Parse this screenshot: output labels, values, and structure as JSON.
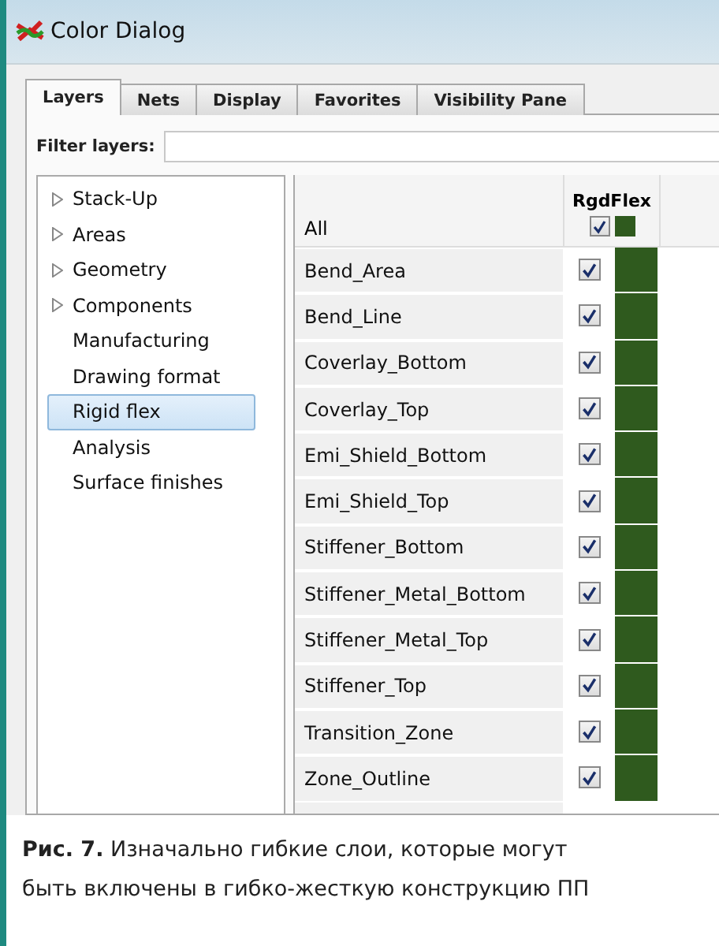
{
  "window": {
    "title": "Color Dialog"
  },
  "tabs": [
    {
      "label": "Layers",
      "selected": true
    },
    {
      "label": "Nets",
      "selected": false
    },
    {
      "label": "Display",
      "selected": false
    },
    {
      "label": "Favorites",
      "selected": false
    },
    {
      "label": "Visibility Pane",
      "selected": false
    }
  ],
  "filter": {
    "label": "Filter layers:"
  },
  "tree": [
    {
      "label": "Stack-Up",
      "kind": "folder",
      "selected": false
    },
    {
      "label": "Areas",
      "kind": "folder",
      "selected": false
    },
    {
      "label": "Geometry",
      "kind": "folder",
      "selected": false
    },
    {
      "label": "Components",
      "kind": "folder",
      "selected": false
    },
    {
      "label": "Manufacturing",
      "kind": "leaf",
      "selected": false
    },
    {
      "label": "Drawing format",
      "kind": "leaf",
      "selected": false
    },
    {
      "label": "Rigid flex",
      "kind": "leaf",
      "selected": true
    },
    {
      "label": "Analysis",
      "kind": "leaf",
      "selected": false
    },
    {
      "label": "Surface finishes",
      "kind": "leaf",
      "selected": false
    }
  ],
  "table": {
    "column": "RgdFlex",
    "all": {
      "label": "All",
      "checked": true,
      "color": "#2f5a1e"
    },
    "rows": [
      {
        "name": "Bend_Area",
        "checked": true,
        "color": "#2f5a1e"
      },
      {
        "name": "Bend_Line",
        "checked": true,
        "color": "#2f5a1e"
      },
      {
        "name": "Coverlay_Bottom",
        "checked": true,
        "color": "#2f5a1e"
      },
      {
        "name": "Coverlay_Top",
        "checked": true,
        "color": "#2f5a1e"
      },
      {
        "name": "Emi_Shield_Bottom",
        "checked": true,
        "color": "#2f5a1e"
      },
      {
        "name": "Emi_Shield_Top",
        "checked": true,
        "color": "#2f5a1e"
      },
      {
        "name": "Stiffener_Bottom",
        "checked": true,
        "color": "#2f5a1e"
      },
      {
        "name": "Stiffener_Metal_Bottom",
        "checked": true,
        "color": "#2f5a1e"
      },
      {
        "name": "Stiffener_Metal_Top",
        "checked": true,
        "color": "#2f5a1e"
      },
      {
        "name": "Stiffener_Top",
        "checked": true,
        "color": "#2f5a1e"
      },
      {
        "name": "Transition_Zone",
        "checked": true,
        "color": "#2f5a1e"
      },
      {
        "name": "Zone_Outline",
        "checked": true,
        "color": "#2f5a1e"
      }
    ]
  },
  "caption": "**Рис. 7.** Изначально гибкие слои, которые могут быть включены в гибко-жесткую конструкцию ПП"
}
